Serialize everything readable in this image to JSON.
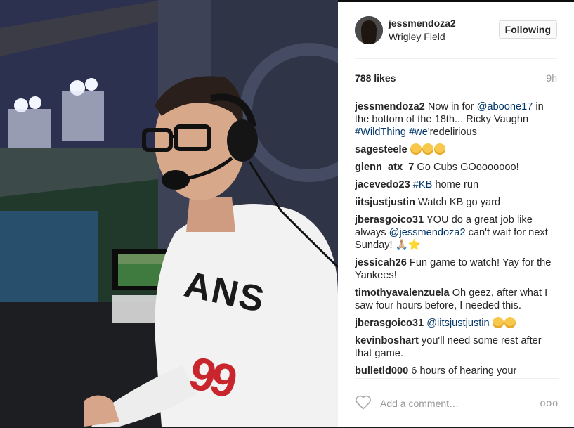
{
  "post": {
    "username": "jessmendoza2",
    "location": "Wrigley Field",
    "follow_label": "Following",
    "likes": "788 likes",
    "time": "9h"
  },
  "comments": [
    {
      "user": "jessmendoza2",
      "parts": [
        {
          "t": "Now in for "
        },
        {
          "t": "@aboone17",
          "link": true
        },
        {
          "t": " in the bottom of the 18th... Ricky Vaughn "
        },
        {
          "t": "#WildThing",
          "link": true
        },
        {
          "t": " "
        },
        {
          "t": "#we",
          "link": true
        },
        {
          "t": "'redelirious"
        }
      ]
    },
    {
      "user": "sagesteele",
      "parts": [],
      "emoji_count": 3
    },
    {
      "user": "glenn_atx_7",
      "parts": [
        {
          "t": "Go Cubs GOooooooo!"
        }
      ]
    },
    {
      "user": "jacevedo23",
      "parts": [
        {
          "t": "#KB",
          "link": true
        },
        {
          "t": " home run"
        }
      ]
    },
    {
      "user": "iitsjustjustin",
      "parts": [
        {
          "t": "Watch KB go yard"
        }
      ]
    },
    {
      "user": "jberasgoico31",
      "parts": [
        {
          "t": "YOU do a great job like always "
        },
        {
          "t": "@jessmendoza2",
          "link": true
        },
        {
          "t": " can't wait for next Sunday! 🙏🏼"
        },
        {
          "t": "⭐",
          "star": true
        }
      ]
    },
    {
      "user": "jessicah26",
      "parts": [
        {
          "t": "Fun game to watch! Yay for the Yankees!"
        }
      ]
    },
    {
      "user": "timothyavalenzuela",
      "parts": [
        {
          "t": "Oh geez, after what I saw four hours before, I needed this."
        }
      ]
    },
    {
      "user": "jberasgoico31",
      "parts": [
        {
          "t": "@iitsjustjustin",
          "link": true
        },
        {
          "t": " "
        }
      ],
      "emoji_count": 2
    },
    {
      "user": "kevinboshart",
      "parts": [
        {
          "t": "you'll need some rest after that game."
        }
      ]
    },
    {
      "user": "bulletld000",
      "parts": [
        {
          "t": "6 hours of hearing your"
        }
      ]
    }
  ],
  "footer": {
    "comment_placeholder": "Add a comment…",
    "more_label": "ooo"
  },
  "photo": {
    "shirt_text": "ANS",
    "number_text": "99"
  }
}
